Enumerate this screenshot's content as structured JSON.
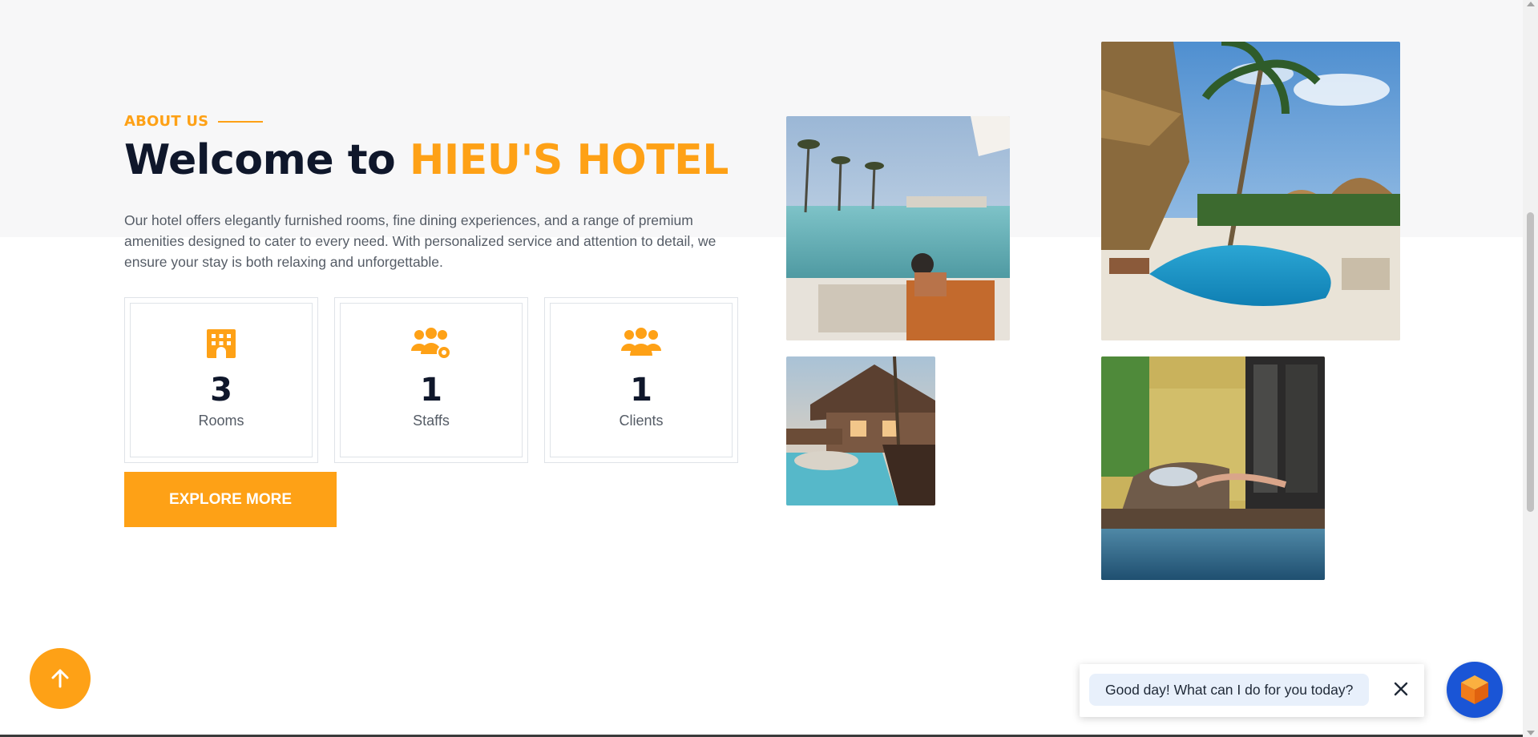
{
  "about": {
    "section_label": "ABOUT US",
    "heading_prefix": "Welcome to ",
    "heading_brand": "HIEU'S HOTEL",
    "description": "Our hotel offers elegantly furnished rooms, fine dining experiences, and a range of premium amenities designed to cater to every need. With personalized service and attention to detail, we ensure your stay is both relaxing and unforgettable."
  },
  "stats": [
    {
      "icon": "hotel-icon",
      "value": "3",
      "label": "Rooms"
    },
    {
      "icon": "staff-settings-icon",
      "value": "1",
      "label": "Staffs"
    },
    {
      "icon": "users-icon",
      "value": "1",
      "label": "Clients"
    }
  ],
  "explore_button": "EXPLORE MORE",
  "gallery": [
    {
      "name": "photo-beach-pool"
    },
    {
      "name": "photo-tropical-resort-pool"
    },
    {
      "name": "photo-poolside-cabin"
    },
    {
      "name": "photo-poolside-lounger"
    }
  ],
  "chat": {
    "greeting": "Good day! What can I do for you today?"
  },
  "colors": {
    "accent": "#fea116",
    "heading": "#0f172b",
    "text": "#555c66",
    "chat_launcher": "#1a55d6"
  }
}
